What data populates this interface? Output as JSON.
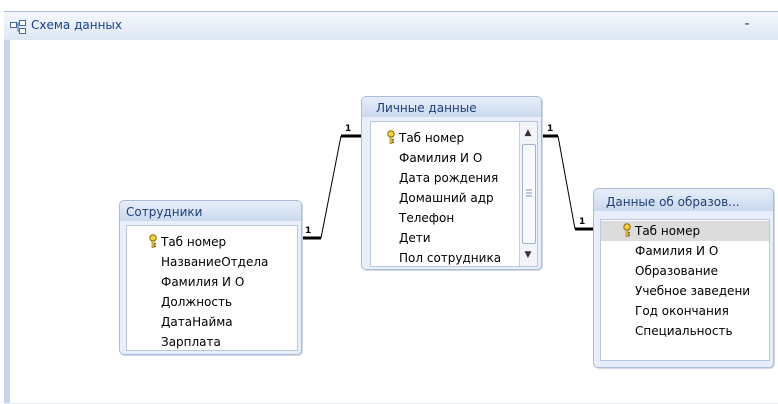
{
  "window": {
    "title": "Схема данных",
    "minimize_label": "-"
  },
  "tables": {
    "employees": {
      "name": "Сотрудники",
      "fields": [
        "Таб номер",
        "НазваниеОтдела",
        "Фамилия И О",
        "Должность",
        "ДатаНайма",
        "Зарплата"
      ],
      "key_field": "Таб номер"
    },
    "personal": {
      "name": "Личные данные",
      "fields": [
        "Таб номер",
        "Фамилия И О",
        "Дата рождения",
        "Домашний адр",
        "Телефон",
        "Дети",
        "Пол сотрудника"
      ],
      "key_field": "Таб номер"
    },
    "education": {
      "name": "Данные об образов...",
      "fields": [
        "Таб номер",
        "Фамилия И О",
        "Образование",
        "Учебное заведени",
        "Год окончания",
        "Специальность"
      ],
      "key_field": "Таб номер",
      "selected_field": "Таб номер"
    }
  },
  "relationships": [
    {
      "from": "Сотрудники.Таб номер",
      "to": "Личные данные.Таб номер",
      "from_label": "1",
      "to_label": "1"
    },
    {
      "from": "Личные данные.Таб номер",
      "to": "Данные об образов....Таб номер",
      "from_label": "1",
      "to_label": "1"
    }
  ],
  "colors": {
    "header": "#cad9ef",
    "border": "#a9bcd9",
    "title_text": "#15428b",
    "selected_row": "#dcdcdc"
  }
}
